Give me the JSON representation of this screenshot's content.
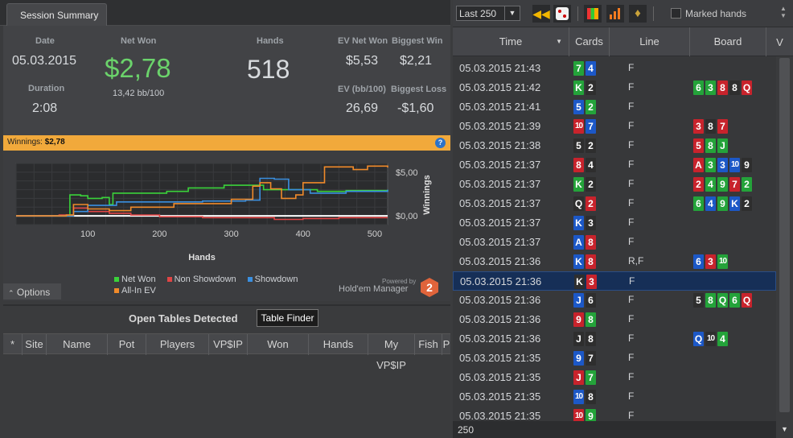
{
  "tab": {
    "label": "Session Summary"
  },
  "summary": {
    "date_label": "Date",
    "date": "05.03.2015",
    "duration_label": "Duration",
    "duration": "2:08",
    "net_won_label": "Net Won",
    "net_won": "$2,78",
    "bb100": "13,42 bb/100",
    "hands_label": "Hands",
    "hands": "518",
    "ev_net_won_label": "EV Net Won",
    "ev_net_won": "$5,53",
    "biggest_win_label": "Biggest Win",
    "biggest_win": "$2,21",
    "ev_bb100_label": "EV (bb/100)",
    "ev_bb100": "26,69",
    "biggest_loss_label": "Biggest Loss",
    "biggest_loss": "-$1,60"
  },
  "winnings_bar": {
    "label": "Winnings:",
    "value": "$2,78",
    "help": "?"
  },
  "chart_data": {
    "type": "line",
    "xlabel": "Hands",
    "ylabel": "Winnings",
    "x_ticks": [
      "100",
      "200",
      "300",
      "400",
      "500"
    ],
    "y_ticks": [
      "$5,00",
      "$0,00"
    ],
    "xlim": [
      0,
      518
    ],
    "ylim": [
      -1,
      6
    ],
    "series": [
      {
        "name": "Net Won",
        "color": "#3ad23a",
        "values": [
          [
            0,
            0
          ],
          [
            70,
            0
          ],
          [
            75,
            2.4
          ],
          [
            90,
            2.3
          ],
          [
            100,
            2.0
          ],
          [
            120,
            2.1
          ],
          [
            130,
            1.3
          ],
          [
            135,
            2.6
          ],
          [
            180,
            2.6
          ],
          [
            210,
            2.8
          ],
          [
            240,
            3.2
          ],
          [
            280,
            3.2
          ],
          [
            290,
            3.5
          ],
          [
            330,
            3.5
          ],
          [
            345,
            3.0
          ],
          [
            380,
            3.0
          ],
          [
            420,
            2.8
          ],
          [
            460,
            2.9
          ],
          [
            518,
            2.78
          ]
        ]
      },
      {
        "name": "Non Showdown",
        "color": "#e04545",
        "values": [
          [
            0,
            0
          ],
          [
            60,
            0.1
          ],
          [
            80,
            0.9
          ],
          [
            100,
            0.5
          ],
          [
            130,
            0.3
          ],
          [
            160,
            0.1
          ],
          [
            200,
            -0.1
          ],
          [
            260,
            -0.2
          ],
          [
            300,
            -0.2
          ],
          [
            360,
            -0.4
          ],
          [
            400,
            -0.3
          ],
          [
            450,
            -0.2
          ],
          [
            518,
            -0.2
          ]
        ]
      },
      {
        "name": "Showdown",
        "color": "#3a8fe0",
        "values": [
          [
            0,
            0
          ],
          [
            80,
            0.5
          ],
          [
            100,
            1.2
          ],
          [
            140,
            1.6
          ],
          [
            200,
            1.6
          ],
          [
            260,
            1.7
          ],
          [
            320,
            1.8
          ],
          [
            340,
            4.3
          ],
          [
            360,
            4.2
          ],
          [
            380,
            3.0
          ],
          [
            410,
            2.6
          ],
          [
            460,
            2.8
          ],
          [
            518,
            3.0
          ]
        ]
      },
      {
        "name": "All-In EV",
        "color": "#f08a2a",
        "values": [
          [
            0,
            0
          ],
          [
            70,
            0.1
          ],
          [
            80,
            1.3
          ],
          [
            100,
            0.8
          ],
          [
            130,
            0.6
          ],
          [
            160,
            1.0
          ],
          [
            220,
            1.4
          ],
          [
            300,
            1.9
          ],
          [
            330,
            3.4
          ],
          [
            340,
            3.8
          ],
          [
            355,
            3.1
          ],
          [
            370,
            2.0
          ],
          [
            390,
            2.4
          ],
          [
            400,
            3.8
          ],
          [
            430,
            5.6
          ],
          [
            470,
            5.3
          ],
          [
            490,
            5.7
          ],
          [
            518,
            5.53
          ]
        ]
      }
    ],
    "legend_position": "bottom",
    "grid": true
  },
  "powered_by": {
    "line1": "Powered by",
    "line2": "Hold'em Manager",
    "logo": "2"
  },
  "options_btn": "Options",
  "open_tables": {
    "title": "Open Tables Detected",
    "finder_btn": "Table Finder",
    "columns": [
      "*",
      "Site",
      "Name",
      "Pot",
      "Players",
      "VP$IP",
      "Won",
      "Hands",
      "My VP$IP",
      "Fish",
      "P"
    ]
  },
  "toolbar": {
    "filter_value": "Last 250",
    "marked_hands_label": "Marked hands"
  },
  "hand_table": {
    "headers": {
      "time": "Time",
      "cards": "Cards",
      "line": "Line",
      "board": "Board",
      "extra": "V"
    },
    "rows": [
      {
        "time": "05.03.2015 21:43",
        "cards": [
          [
            "7",
            "c"
          ],
          [
            "4",
            "d"
          ]
        ],
        "line": "F",
        "board": []
      },
      {
        "time": "05.03.2015 21:42",
        "cards": [
          [
            "K",
            "c"
          ],
          [
            "2",
            "s"
          ]
        ],
        "line": "F",
        "board": [
          [
            "6",
            "c"
          ],
          [
            "3",
            "c"
          ],
          [
            "8",
            "h"
          ],
          [
            "8",
            "s"
          ],
          [
            "Q",
            "h"
          ]
        ]
      },
      {
        "time": "05.03.2015 21:41",
        "cards": [
          [
            "5",
            "d"
          ],
          [
            "2",
            "c"
          ]
        ],
        "line": "F",
        "board": []
      },
      {
        "time": "05.03.2015 21:39",
        "cards": [
          [
            "10",
            "h"
          ],
          [
            "7",
            "d"
          ]
        ],
        "line": "F",
        "board": [
          [
            "3",
            "h"
          ],
          [
            "8",
            "s"
          ],
          [
            "7",
            "h"
          ]
        ]
      },
      {
        "time": "05.03.2015 21:38",
        "cards": [
          [
            "5",
            "s"
          ],
          [
            "2",
            "s"
          ]
        ],
        "line": "F",
        "board": [
          [
            "5",
            "h"
          ],
          [
            "8",
            "c"
          ],
          [
            "J",
            "c"
          ]
        ]
      },
      {
        "time": "05.03.2015 21:37",
        "cards": [
          [
            "8",
            "h"
          ],
          [
            "4",
            "s"
          ]
        ],
        "line": "F",
        "board": [
          [
            "A",
            "h"
          ],
          [
            "3",
            "c"
          ],
          [
            "3",
            "d"
          ],
          [
            "10",
            "d"
          ],
          [
            "9",
            "s"
          ]
        ]
      },
      {
        "time": "05.03.2015 21:37",
        "cards": [
          [
            "K",
            "c"
          ],
          [
            "2",
            "s"
          ]
        ],
        "line": "F",
        "board": [
          [
            "2",
            "h"
          ],
          [
            "4",
            "c"
          ],
          [
            "9",
            "c"
          ],
          [
            "7",
            "h"
          ],
          [
            "2",
            "c"
          ]
        ]
      },
      {
        "time": "05.03.2015 21:37",
        "cards": [
          [
            "Q",
            "s"
          ],
          [
            "2",
            "h"
          ]
        ],
        "line": "F",
        "board": [
          [
            "6",
            "c"
          ],
          [
            "4",
            "d"
          ],
          [
            "9",
            "c"
          ],
          [
            "K",
            "d"
          ],
          [
            "2",
            "s"
          ]
        ]
      },
      {
        "time": "05.03.2015 21:37",
        "cards": [
          [
            "K",
            "d"
          ],
          [
            "3",
            "s"
          ]
        ],
        "line": "F",
        "board": []
      },
      {
        "time": "05.03.2015 21:37",
        "cards": [
          [
            "A",
            "d"
          ],
          [
            "8",
            "h"
          ]
        ],
        "line": "F",
        "board": []
      },
      {
        "time": "05.03.2015 21:36",
        "cards": [
          [
            "K",
            "d"
          ],
          [
            "8",
            "h"
          ]
        ],
        "line": "R,F",
        "board": [
          [
            "6",
            "d"
          ],
          [
            "3",
            "h"
          ],
          [
            "10",
            "c"
          ]
        ]
      },
      {
        "time": "05.03.2015 21:36",
        "cards": [
          [
            "K",
            "s"
          ],
          [
            "3",
            "h"
          ]
        ],
        "line": "F",
        "board": [],
        "selected": true
      },
      {
        "time": "05.03.2015 21:36",
        "cards": [
          [
            "J",
            "d"
          ],
          [
            "6",
            "s"
          ]
        ],
        "line": "F",
        "board": [
          [
            "5",
            "s"
          ],
          [
            "8",
            "c"
          ],
          [
            "Q",
            "c"
          ],
          [
            "6",
            "c"
          ],
          [
            "Q",
            "h"
          ]
        ]
      },
      {
        "time": "05.03.2015 21:36",
        "cards": [
          [
            "9",
            "h"
          ],
          [
            "8",
            "c"
          ]
        ],
        "line": "F",
        "board": []
      },
      {
        "time": "05.03.2015 21:36",
        "cards": [
          [
            "J",
            "s"
          ],
          [
            "8",
            "s"
          ]
        ],
        "line": "F",
        "board": [
          [
            "Q",
            "d"
          ],
          [
            "10",
            "s"
          ],
          [
            "4",
            "c"
          ]
        ]
      },
      {
        "time": "05.03.2015 21:35",
        "cards": [
          [
            "9",
            "d"
          ],
          [
            "7",
            "s"
          ]
        ],
        "line": "F",
        "board": []
      },
      {
        "time": "05.03.2015 21:35",
        "cards": [
          [
            "J",
            "h"
          ],
          [
            "7",
            "c"
          ]
        ],
        "line": "F",
        "board": []
      },
      {
        "time": "05.03.2015 21:35",
        "cards": [
          [
            "10",
            "d"
          ],
          [
            "8",
            "s"
          ]
        ],
        "line": "F",
        "board": []
      },
      {
        "time": "05.03.2015 21:35",
        "cards": [
          [
            "10",
            "h"
          ],
          [
            "9",
            "c"
          ]
        ],
        "line": "F",
        "board": []
      }
    ]
  },
  "footer": {
    "count": "250"
  }
}
